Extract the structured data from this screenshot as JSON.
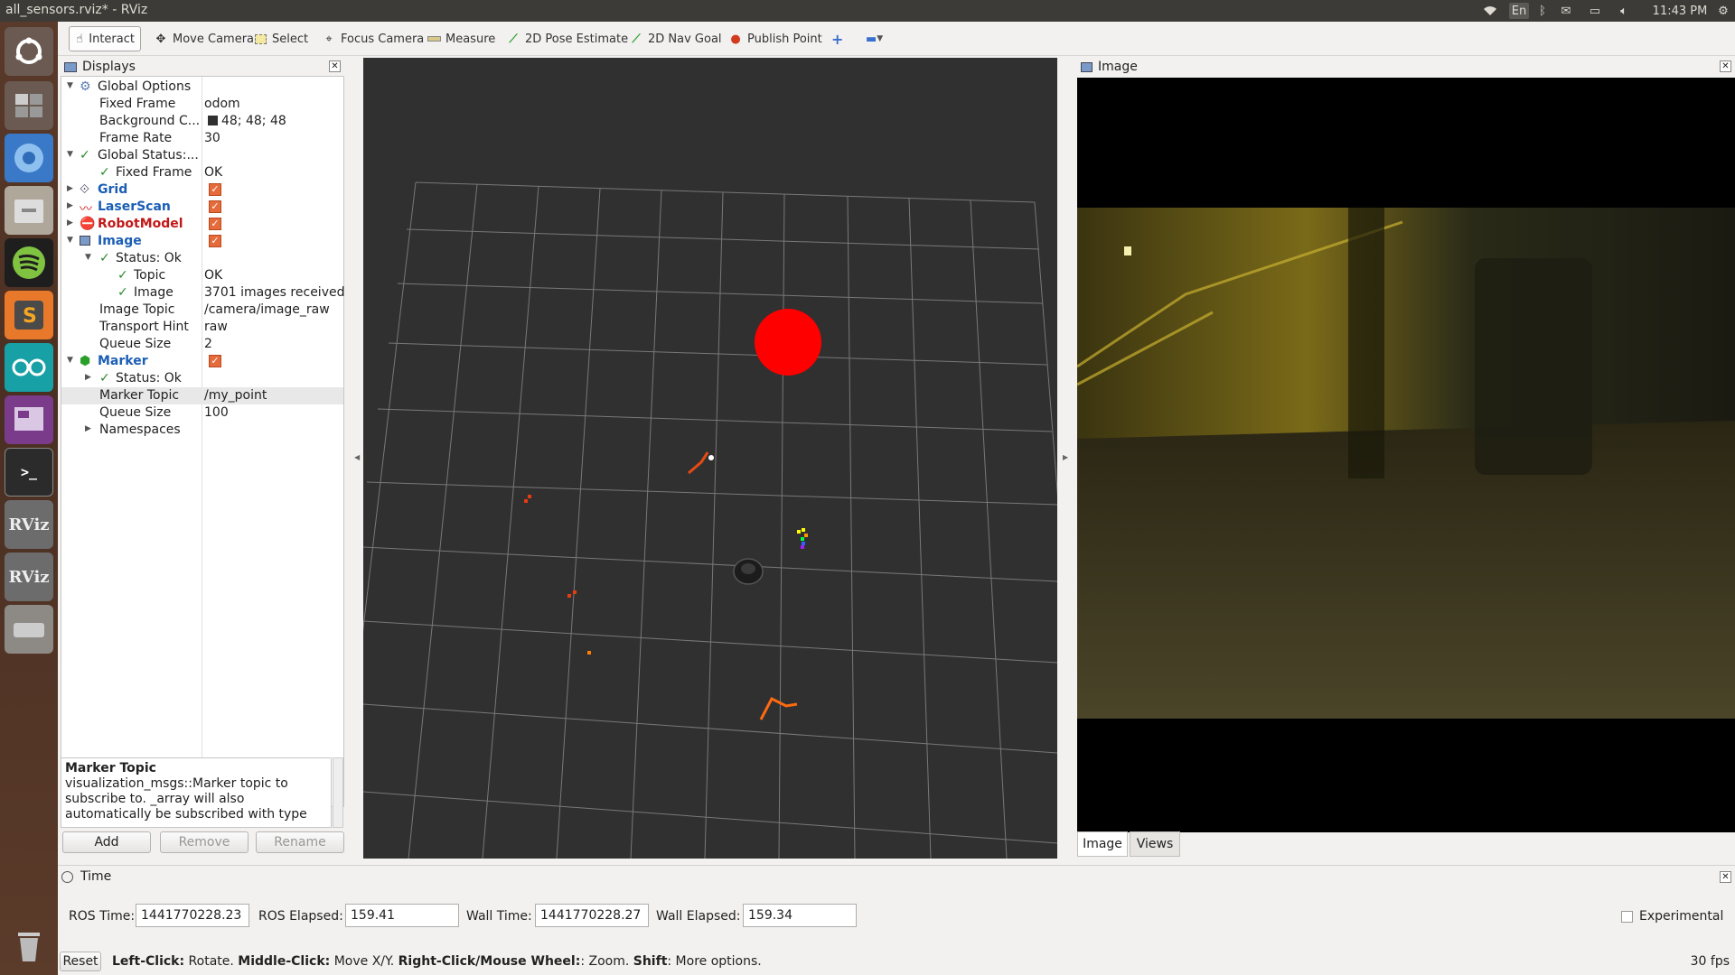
{
  "window": {
    "title": "all_sensors.rviz* - RViz"
  },
  "systray": {
    "keyboard": "En",
    "clock": "11:43 PM"
  },
  "toolbar": {
    "tools": [
      {
        "label": "Interact",
        "icon": "hand-icon"
      },
      {
        "label": "Move Camera",
        "icon": "move-icon"
      },
      {
        "label": "Select",
        "icon": "select-icon"
      },
      {
        "label": "Focus Camera",
        "icon": "focus-icon"
      },
      {
        "label": "Measure",
        "icon": "ruler-icon"
      },
      {
        "label": "2D Pose Estimate",
        "icon": "arrow-green-icon"
      },
      {
        "label": "2D Nav Goal",
        "icon": "arrow-green-icon"
      },
      {
        "label": "Publish Point",
        "icon": "pin-icon"
      }
    ]
  },
  "displays": {
    "title": "Displays",
    "rows": [
      {
        "key": "Global Options"
      },
      {
        "key": "Fixed Frame",
        "value": "odom"
      },
      {
        "key": "Background C...",
        "value": "48; 48; 48"
      },
      {
        "key": "Frame Rate",
        "value": "30"
      },
      {
        "key": "Global Status:..."
      },
      {
        "key": "Fixed Frame",
        "value": "OK"
      },
      {
        "key": "Grid"
      },
      {
        "key": "LaserScan"
      },
      {
        "key": "RobotModel"
      },
      {
        "key": "Image"
      },
      {
        "key": "Status: Ok"
      },
      {
        "key": "Topic",
        "value": "OK"
      },
      {
        "key": "Image",
        "value": "3701 images received"
      },
      {
        "key": "Image Topic",
        "value": "/camera/image_raw"
      },
      {
        "key": "Transport Hint",
        "value": "raw"
      },
      {
        "key": "Queue Size",
        "value": "2"
      },
      {
        "key": "Marker"
      },
      {
        "key": "Status: Ok"
      },
      {
        "key": "Marker Topic",
        "value": "/my_point"
      },
      {
        "key": "Queue Size",
        "value": "100"
      },
      {
        "key": "Namespaces"
      }
    ],
    "description": {
      "title": "Marker Topic",
      "body": "visualization_msgs::Marker topic to subscribe to. _array will also automatically be subscribed with type"
    },
    "buttons": {
      "add": "Add",
      "remove": "Remove",
      "rename": "Rename"
    }
  },
  "image_panel": {
    "title": "Image",
    "tabs": [
      "Image",
      "Views"
    ]
  },
  "time_panel": {
    "title": "Time",
    "ros_time_label": "ROS Time:",
    "ros_time": "1441770228.23",
    "ros_elapsed_label": "ROS Elapsed:",
    "ros_elapsed": "159.41",
    "wall_time_label": "Wall Time:",
    "wall_time": "1441770228.27",
    "wall_elapsed_label": "Wall Elapsed:",
    "wall_elapsed": "159.34",
    "experimental_label": "Experimental"
  },
  "statusbar": {
    "reset": "Reset",
    "hint_left_b": "Left-Click:",
    "hint_left": " Rotate. ",
    "hint_mid_b": "Middle-Click:",
    "hint_mid": " Move X/Y. ",
    "hint_right_b": "Right-Click/Mouse Wheel:",
    "hint_right": ": Zoom. ",
    "hint_shift_b": "Shift",
    "hint_shift": ": More options.",
    "fps": "30 fps"
  },
  "colors": {
    "background": "#303030",
    "marker": "#ff0000",
    "accent_check": "#e66a3a"
  }
}
